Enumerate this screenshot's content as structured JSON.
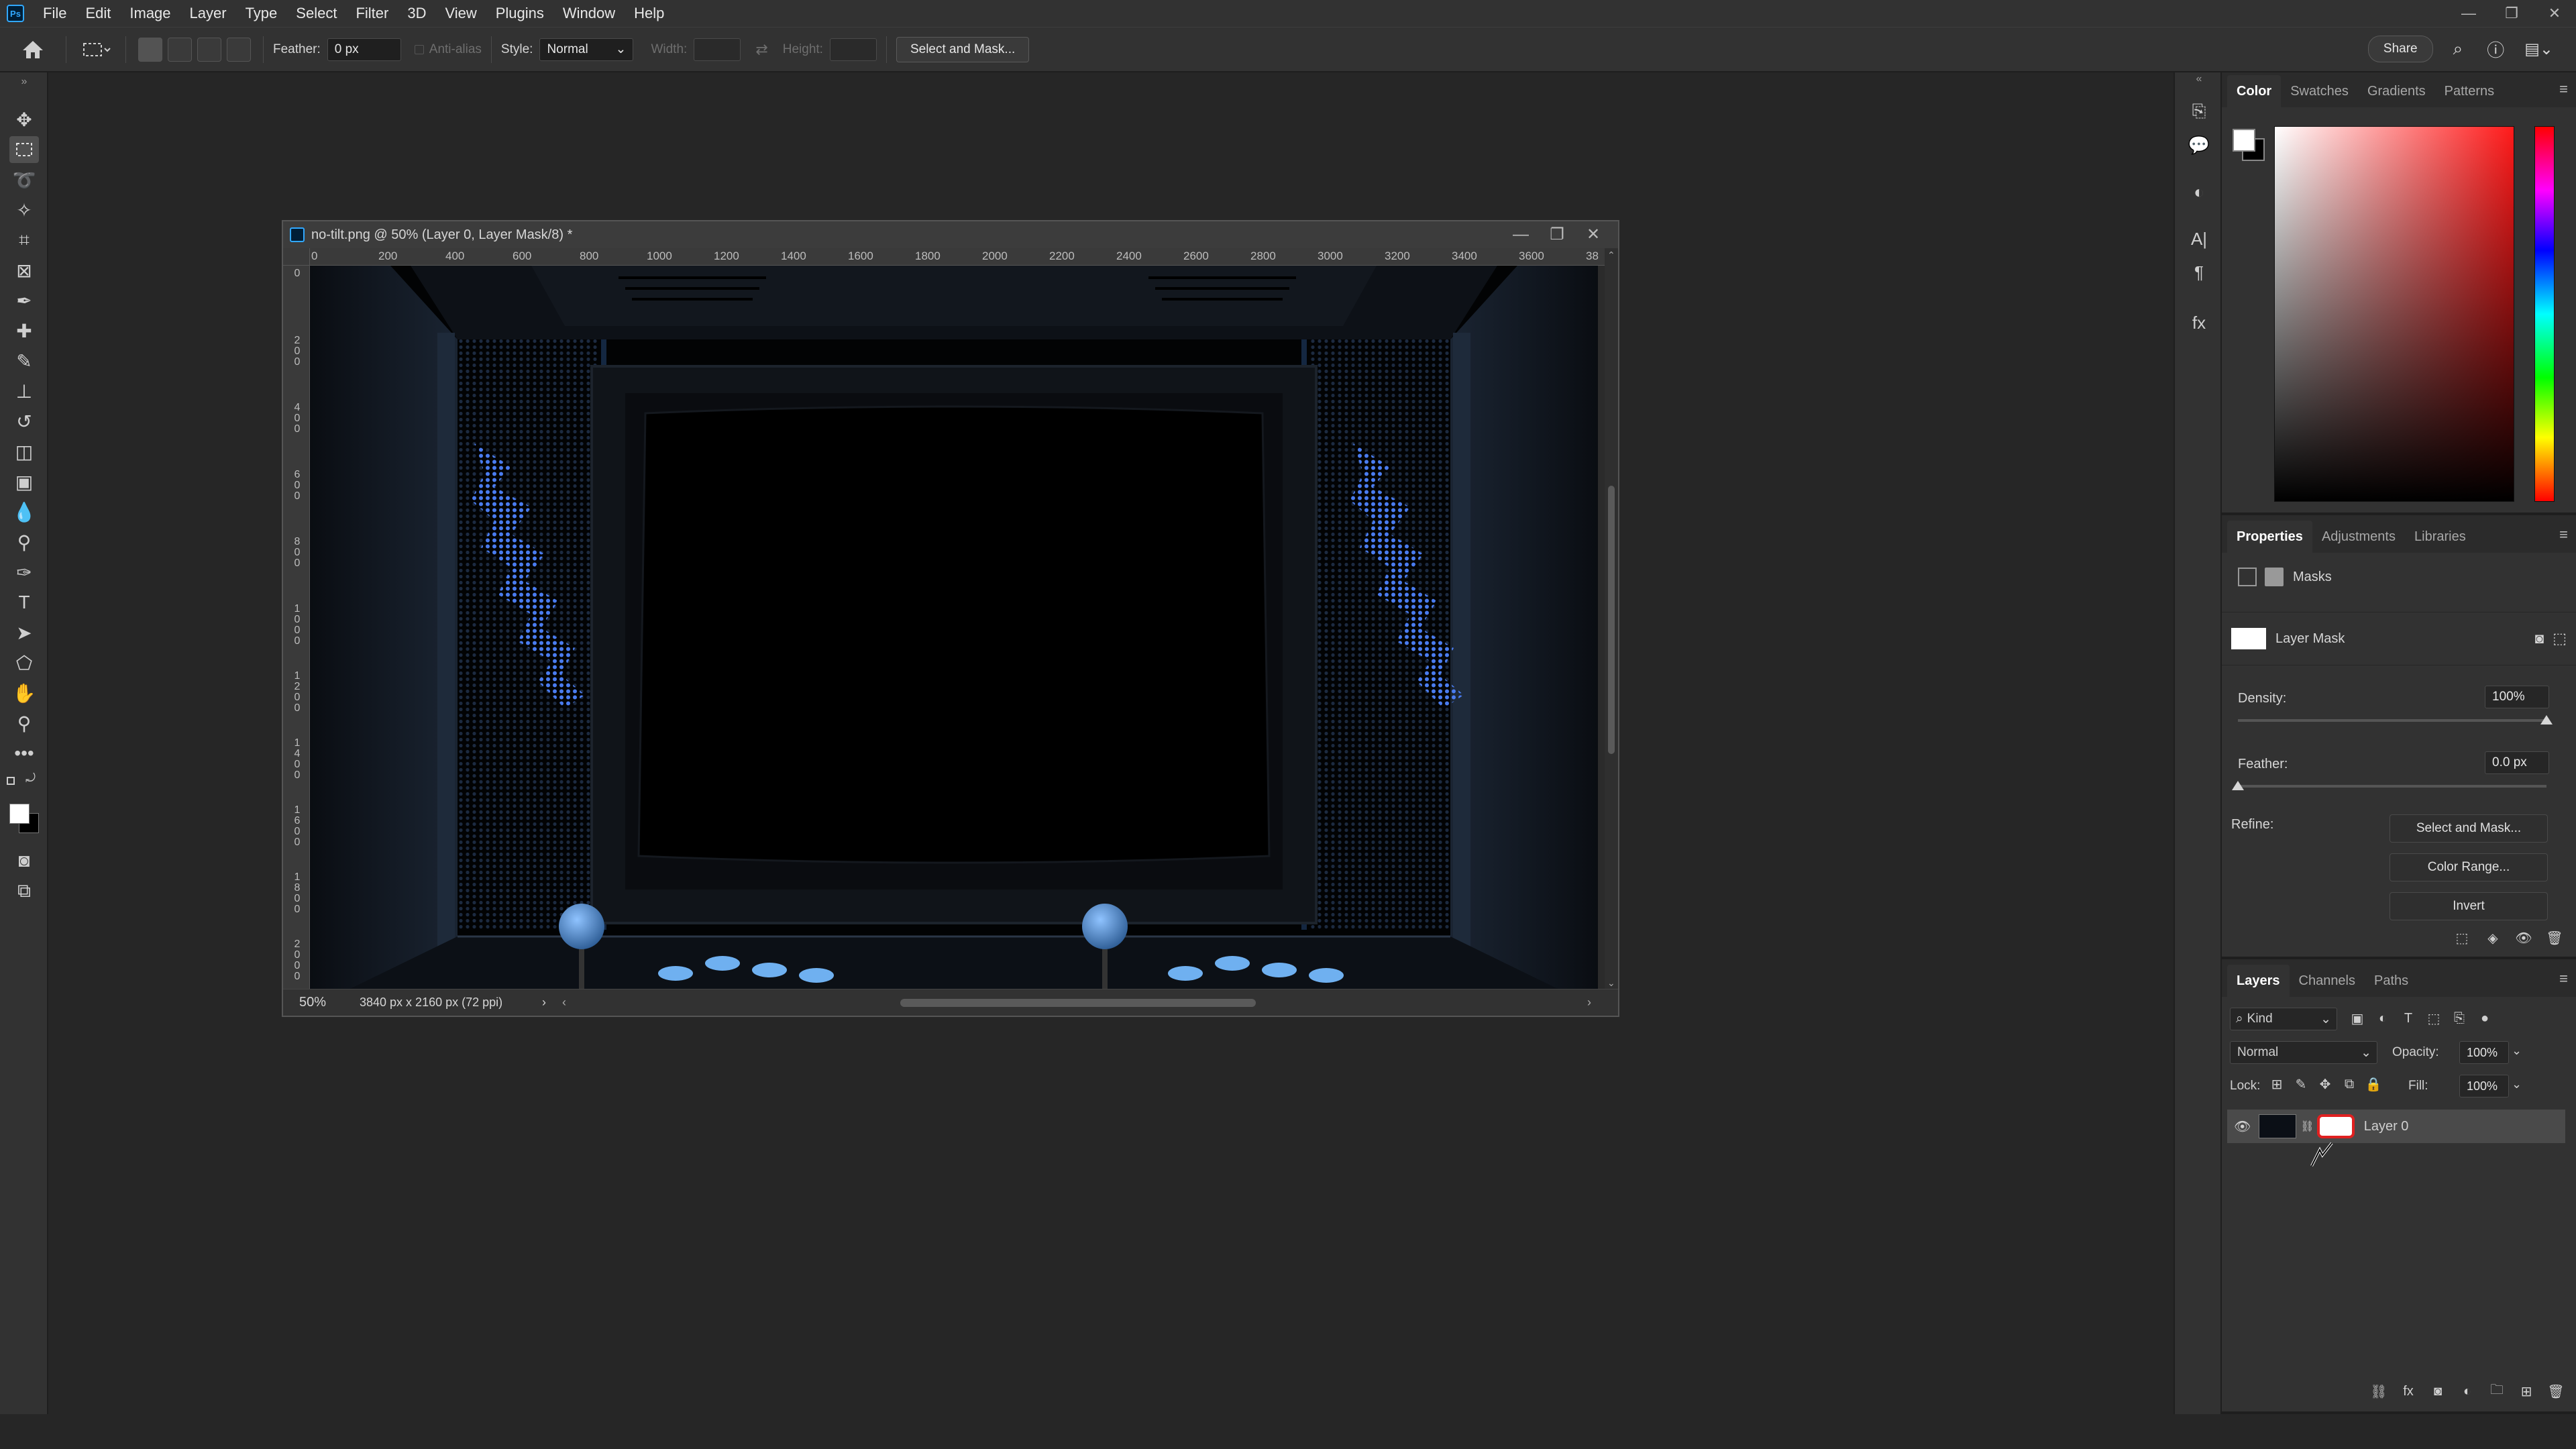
{
  "menu": {
    "items": [
      "File",
      "Edit",
      "Image",
      "Layer",
      "Type",
      "Select",
      "Filter",
      "3D",
      "View",
      "Plugins",
      "Window",
      "Help"
    ],
    "logo": "Ps",
    "window_controls": [
      "—",
      "❐",
      "✕"
    ]
  },
  "options": {
    "feather_label": "Feather:",
    "feather_value": "0 px",
    "antialias_label": "Anti-alias",
    "style_label": "Style:",
    "style_value": "Normal",
    "width_label": "Width:",
    "height_label": "Height:",
    "select_mask_label": "Select and Mask...",
    "share_label": "Share"
  },
  "document": {
    "title": "no-tilt.png @ 50% (Layer 0, Layer Mask/8) *",
    "zoom": "50%",
    "dimensions": "3840 px x 2160 px (72 ppi)",
    "ruler_h": [
      "0",
      "200",
      "400",
      "600",
      "800",
      "1000",
      "1200",
      "1400",
      "1600",
      "1800",
      "2000",
      "2200",
      "2400",
      "2600",
      "2800",
      "3000",
      "3200",
      "3400",
      "3600",
      "38"
    ],
    "ruler_v": [
      "0",
      "200",
      "400",
      "600",
      "800",
      "1000",
      "1200",
      "1400",
      "1600",
      "1800",
      "2000"
    ],
    "controls": [
      "—",
      "❐",
      "✕"
    ]
  },
  "color_panel": {
    "tabs": [
      "Color",
      "Swatches",
      "Gradients",
      "Patterns"
    ],
    "foreground": "#ffffff",
    "background": "#000000"
  },
  "properties_panel": {
    "tabs": [
      "Properties",
      "Adjustments",
      "Libraries"
    ],
    "section_label": "Masks",
    "mask_label": "Layer Mask",
    "density_label": "Density:",
    "density_value": "100%",
    "feather_label": "Feather:",
    "feather_value": "0.0 px",
    "refine_label": "Refine:",
    "select_mask_button": "Select and Mask...",
    "color_range_button": "Color Range...",
    "invert_button": "Invert"
  },
  "layers_panel": {
    "tabs": [
      "Layers",
      "Channels",
      "Paths"
    ],
    "filter_label": "Kind",
    "blend_mode": "Normal",
    "opacity_label": "Opacity:",
    "opacity_value": "100%",
    "lock_label": "Lock:",
    "fill_label": "Fill:",
    "fill_value": "100%",
    "layers": [
      {
        "name": "Layer 0",
        "visible": true
      }
    ]
  },
  "colors": {
    "accent_blue": "#31a8ff",
    "highlight_red": "#e02020",
    "panel_bg": "#323232",
    "workspace_bg": "#262626"
  }
}
